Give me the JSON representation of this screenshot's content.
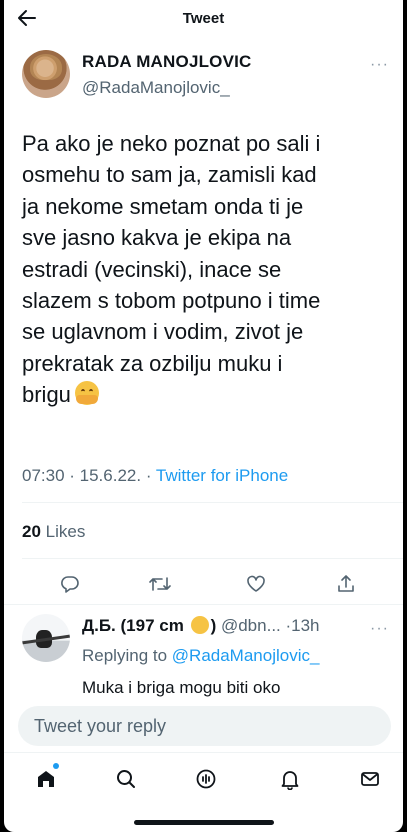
{
  "header": {
    "title": "Tweet"
  },
  "tweet": {
    "author_name": "RADA MANOJLOVIC",
    "author_handle": "@RadaManojlovic_",
    "lines": [
      "Pa ako je neko poznat po sali i",
      "osmehu to sam ja, zamisli kad",
      "ja nekome smetam onda ti je",
      "sve jasno kakva je ekipa na",
      "estradi (vecinski), inace se",
      "slazem s tobom potpuno i time",
      "se uglavnom i vodim, zivot je",
      "prekratak za ozbilju muku i",
      "brigu"
    ],
    "time": "07:30 · 15.6.22. · ",
    "source": "Twitter for iPhone",
    "likes_count": "20",
    "likes_label": "Likes"
  },
  "reply": {
    "name": "Д.Б. (197 cm",
    "name_suffix": ")",
    "handle": "@dbn... ·13h",
    "replying_prefix": "Replying to ",
    "replying_to": "@RadaManojlovic_",
    "text": "Muka i briga mogu biti oko"
  },
  "composer": {
    "placeholder": "Tweet your reply"
  },
  "icons": {
    "back": "arrow-left-icon",
    "more": "more-dots-icon",
    "emoji": "hugging-face-emoji",
    "reply_emoji": "laughing-emoji",
    "actions": [
      "reply-icon",
      "retweet-icon",
      "like-icon",
      "share-icon"
    ],
    "nav": [
      "home-icon",
      "search-icon",
      "spaces-icon",
      "notifications-icon",
      "messages-icon"
    ]
  },
  "colors": {
    "accent": "#1d9bf0",
    "text": "#0f1419",
    "secondary": "#536471"
  }
}
